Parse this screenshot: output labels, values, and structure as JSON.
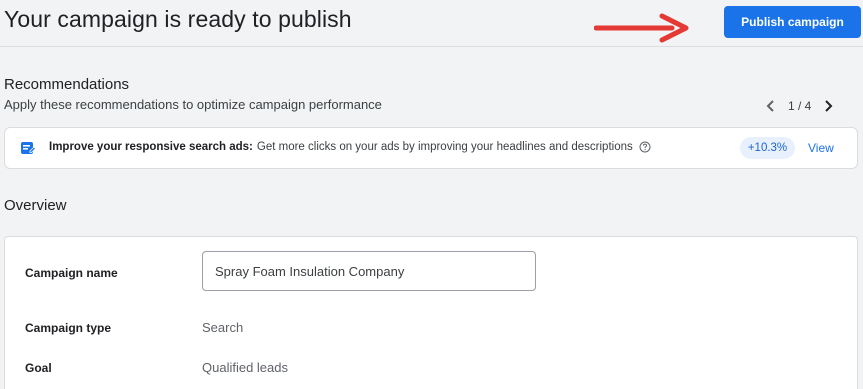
{
  "header": {
    "title": "Your campaign is ready to publish",
    "publish_label": "Publish campaign"
  },
  "colors": {
    "primary": "#1a73e8",
    "arrow": "#e53935",
    "badge_bg": "#e8f0fe"
  },
  "recommendations": {
    "title": "Recommendations",
    "subtitle": "Apply these recommendations to optimize campaign performance",
    "pager": "1 / 4",
    "card": {
      "icon": "ad-edit-icon",
      "bold_text": "Improve your responsive search ads:",
      "text": "Get more clicks on your ads by improving your headlines and descriptions",
      "uplift": "+10.3%",
      "action_label": "View"
    }
  },
  "overview": {
    "title": "Overview",
    "fields": {
      "campaign_name_label": "Campaign name",
      "campaign_name_value": "Spray Foam Insulation Company",
      "campaign_type_label": "Campaign type",
      "campaign_type_value": "Search",
      "goal_label": "Goal",
      "goal_value": "Qualified leads"
    }
  }
}
